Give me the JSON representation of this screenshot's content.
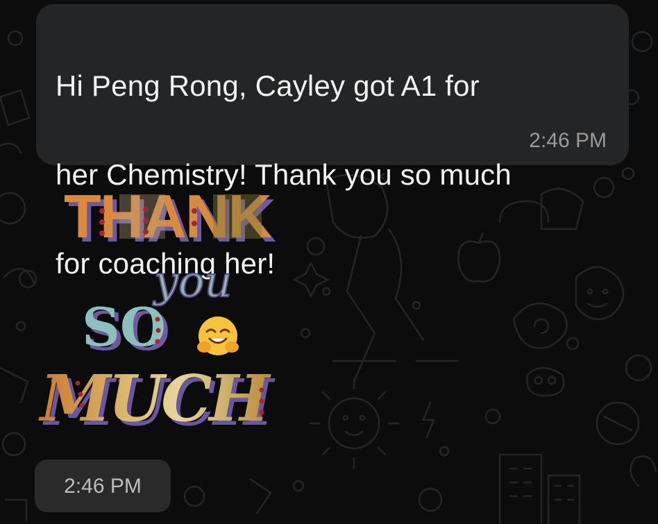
{
  "message": {
    "lines": [
      "Hi Peng Rong, Cayley got A1 for",
      "her Chemistry! Thank you so much",
      "for coaching her!"
    ],
    "time": "2:46 PM"
  },
  "sticker": {
    "word_1": "THANK",
    "word_2": "you",
    "word_3": "SO",
    "word_4": "MUCH",
    "emoji": "hugging-face",
    "time": "2:46 PM"
  },
  "colors": {
    "background": "#0c0c0c",
    "bubble": "#242526",
    "text": "#f2f2f2",
    "timestamp": "#9a9a9a"
  }
}
